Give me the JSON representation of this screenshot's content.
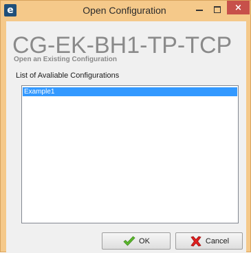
{
  "window": {
    "title": "Open Configuration",
    "app_icon_letter": "e",
    "close_glyph": "×",
    "controls": [
      "minimize-icon",
      "maximize-icon",
      "close-icon"
    ],
    "accent": "#f5c98a",
    "close_color": "#c7504a"
  },
  "header": {
    "product_name": "CG-EK-BH1-TP-TCP",
    "subtitle": "Open an Existing Configuration"
  },
  "list": {
    "label": "List of Avaliable Configurations",
    "items": [
      "Example1"
    ],
    "selected_index": 0,
    "selection_color": "#3399ff"
  },
  "buttons": {
    "ok_label": "OK",
    "ok_icon": "check-icon",
    "cancel_label": "Cancel",
    "cancel_icon": "red-x-icon"
  }
}
